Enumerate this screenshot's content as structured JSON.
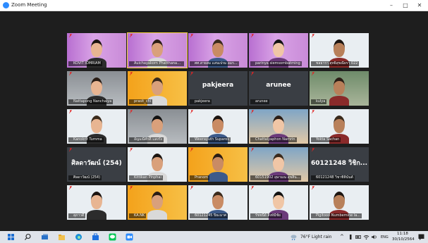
{
  "window": {
    "title": "Zoom Meeting",
    "minimize": "–",
    "maximize": "□",
    "close": "✕"
  },
  "participants": [
    {
      "name": "KOVIT IOMRIAM",
      "bg": "purple",
      "active": false
    },
    {
      "name": "Auichayakorn Phatthanaprasit",
      "bg": "purple",
      "active": true
    },
    {
      "name": "ศศ.สายสม แสนเปรม อมร...",
      "bg": "purple",
      "active": false
    },
    {
      "name": "parinya siemsombatming",
      "bg": "purple",
      "active": false
    },
    {
      "name": "ชลธารา สุทธิสุขณียรา 022",
      "bg": "white",
      "active": false
    },
    {
      "name": "Nattapong Nanchaiya",
      "bg": "room",
      "active": false
    },
    {
      "name": "prasit_chi",
      "bg": "orange",
      "active": false
    },
    {
      "name": "pakjeera",
      "bg": "dark",
      "active": false,
      "big": "pakjeera"
    },
    {
      "name": "arunee",
      "bg": "dark",
      "active": false,
      "big": "arunee"
    },
    {
      "name": "kulya",
      "bg": "green",
      "active": false
    },
    {
      "name": "Kanokrit Tumma",
      "bg": "white",
      "active": false
    },
    {
      "name": "อัญมณีศักดิ์ แสงรัง",
      "bg": "room",
      "active": false
    },
    {
      "name": "Weerayuth Suparos",
      "bg": "white",
      "active": false
    },
    {
      "name": "Chattaiyaphon Namrin",
      "bg": "sky",
      "active": false
    },
    {
      "name": "Yokta Sachan",
      "bg": "white",
      "active": false
    },
    {
      "name": "ศิลดาวัฒน์ (254)",
      "bg": "dark",
      "active": false,
      "big": "ศิลดาวัฒน์ (254)"
    },
    {
      "name": "Kittikan Pinphai",
      "bg": "white",
      "active": false
    },
    {
      "name": "Pranom",
      "bg": "orange",
      "active": false
    },
    {
      "name": "60151902 อุษามณ สุขสิน...",
      "bg": "sky",
      "active": false
    },
    {
      "name": "60121248 วิชาชิตินันต์",
      "bg": "dark",
      "active": false,
      "big": "60121248 วิชิก..."
    },
    {
      "name": "สุภาวดี",
      "bg": "white",
      "active": false
    },
    {
      "name": "KA.NK",
      "bg": "orange",
      "active": false
    },
    {
      "name": "60121245 ปิยะมาศ",
      "bg": "white",
      "active": false
    },
    {
      "name": "รัชชนีย์ สิงห์มีชัย",
      "bg": "white",
      "active": false
    },
    {
      "name": "Pigitood Numbemine la...",
      "bg": "white",
      "active": false
    }
  ],
  "taskbar": {
    "weather": "76°F  Light rain",
    "language": "ENG",
    "time": "11:18",
    "date": "30/10/2564"
  },
  "colors": {
    "active_outline": "#f5d33b",
    "zoom_blue": "#2d8cff",
    "mic_red": "#e02424"
  }
}
